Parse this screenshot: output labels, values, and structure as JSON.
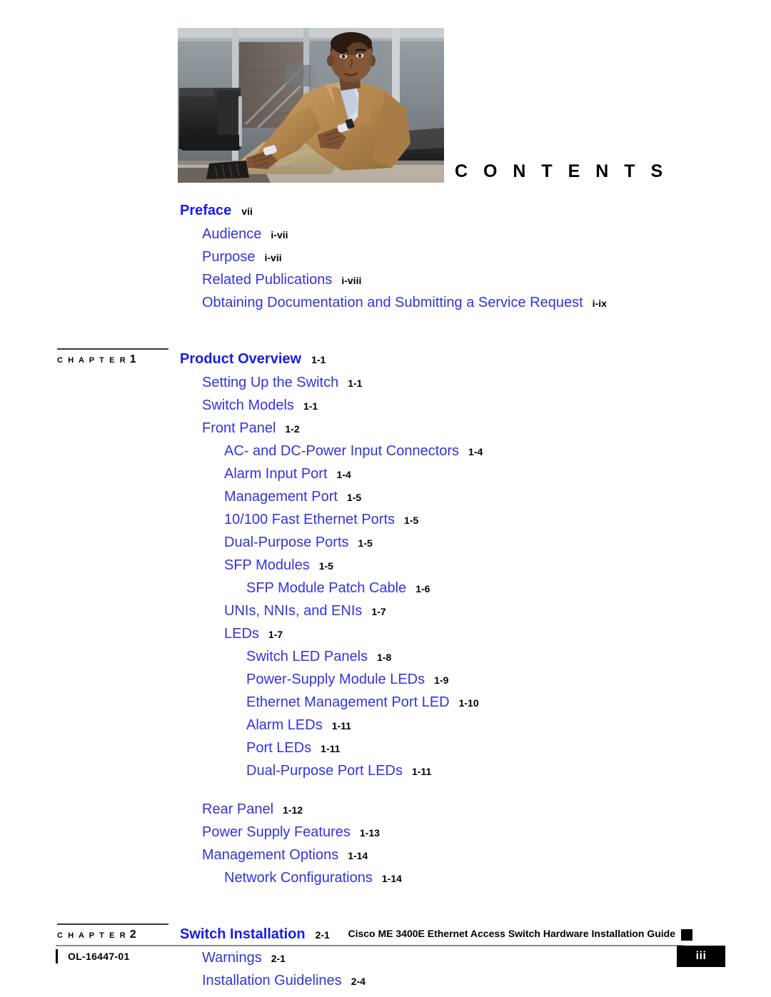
{
  "document": {
    "contents_heading": "C O N T E N T S",
    "photo_alt": "seated-man-photo"
  },
  "toc": {
    "preface": {
      "title": "Preface",
      "page": "vii",
      "entries": [
        {
          "label": "Audience",
          "page": "i-vii",
          "level": 1
        },
        {
          "label": "Purpose",
          "page": "i-vii",
          "level": 1
        },
        {
          "label": "Related Publications",
          "page": "i-viii",
          "level": 1
        },
        {
          "label": "Obtaining Documentation and Submitting a Service Request",
          "page": "i-ix",
          "level": 1
        }
      ]
    },
    "chapters": [
      {
        "chapter_label": "C H A P T E R",
        "chapter_number": "1",
        "title": "Product Overview",
        "page": "1-1",
        "entries": [
          {
            "label": "Setting Up the Switch",
            "page": "1-1",
            "level": 1
          },
          {
            "label": "Switch Models",
            "page": "1-1",
            "level": 1
          },
          {
            "label": "Front Panel",
            "page": "1-2",
            "level": 1
          },
          {
            "label": "AC- and DC-Power Input Connectors",
            "page": "1-4",
            "level": 2
          },
          {
            "label": "Alarm Input Port",
            "page": "1-4",
            "level": 2
          },
          {
            "label": "Management Port",
            "page": "1-5",
            "level": 2
          },
          {
            "label": "10/100 Fast Ethernet Ports",
            "page": "1-5",
            "level": 2
          },
          {
            "label": "Dual-Purpose Ports",
            "page": "1-5",
            "level": 2
          },
          {
            "label": "SFP Modules",
            "page": "1-5",
            "level": 2
          },
          {
            "label": "SFP Module Patch Cable",
            "page": "1-6",
            "level": 3
          },
          {
            "label": "UNIs, NNIs, and ENIs",
            "page": "1-7",
            "level": 2
          },
          {
            "label": "LEDs",
            "page": "1-7",
            "level": 2
          },
          {
            "label": "Switch LED Panels",
            "page": "1-8",
            "level": 3
          },
          {
            "label": "Power-Supply Module LEDs",
            "page": "1-9",
            "level": 3
          },
          {
            "label": "Ethernet Management Port LED",
            "page": "1-10",
            "level": 3
          },
          {
            "label": "Alarm LEDs",
            "page": "1-11",
            "level": 3
          },
          {
            "label": "Port LEDs",
            "page": "1-11",
            "level": 3
          },
          {
            "label": "Dual-Purpose Port LEDs",
            "page": "1-11",
            "level": 3
          },
          {
            "label": "Rear Panel",
            "page": "1-12",
            "level": 1,
            "gap_before": true
          },
          {
            "label": "Power Supply Features",
            "page": "1-13",
            "level": 1
          },
          {
            "label": "Management Options",
            "page": "1-14",
            "level": 1
          },
          {
            "label": "Network Configurations",
            "page": "1-14",
            "level": 2
          }
        ]
      },
      {
        "chapter_label": "C H A P T E R",
        "chapter_number": "2",
        "title": "Switch Installation",
        "page": "2-1",
        "entries": [
          {
            "label": "Warnings",
            "page": "2-1",
            "level": 1
          },
          {
            "label": "Installation Guidelines",
            "page": "2-4",
            "level": 1
          }
        ]
      }
    ]
  },
  "footer": {
    "guide_title": "Cisco ME 3400E Ethernet Access Switch Hardware Installation Guide",
    "doc_id": "OL-16447-01",
    "page_number": "iii"
  },
  "colors": {
    "heading_blue": "#1a1ae8",
    "entry_blue": "#3333e0",
    "text_black": "#000000",
    "rule_gray": "#8c8c8c"
  }
}
